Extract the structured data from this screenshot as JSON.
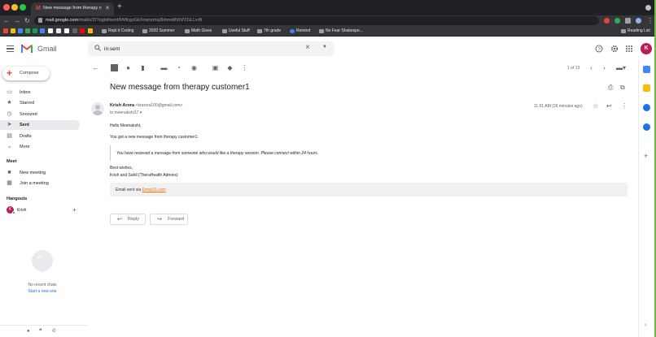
{
  "browser": {
    "tab_title": "New message from therapy cu",
    "url_host": "mail.google.com",
    "url_path": "/mail/u/2/?ogbl#sent/FMfcgzGkXcwnzmqZkbmvltNXPZGLLvrB",
    "bookmarks": [
      "Repl.it Coding",
      "2020 Summer",
      "Math Gives",
      "Useful Stuff",
      "7th grade",
      "Remind",
      "No Fear Shakespe..."
    ],
    "reading_list": "Reading List"
  },
  "gmail": {
    "logo_text": "Gmail",
    "search_value": "in:sent",
    "avatar_letter": "K",
    "compose_label": "Compose",
    "nav": [
      {
        "label": "Inbox",
        "icon": "inbox-icon"
      },
      {
        "label": "Starred",
        "icon": "star-icon"
      },
      {
        "label": "Snoozed",
        "icon": "clock-icon"
      },
      {
        "label": "Sent",
        "icon": "send-icon"
      },
      {
        "label": "Drafts",
        "icon": "draft-icon"
      },
      {
        "label": "More",
        "icon": "chevron-down-icon"
      }
    ],
    "meet": {
      "heading": "Meet",
      "new_meeting": "New meeting",
      "join_meeting": "Join a meeting"
    },
    "hangouts": {
      "heading": "Hangouts",
      "user": "Krish",
      "user_initial": "K",
      "no_chats": "No recent chats",
      "start_new": "Start a new one"
    }
  },
  "message": {
    "pager": "1 of 13",
    "subject": "New message from therapy customer1",
    "from_name": "Krish Arora",
    "from_email": "<krarora100@gmail.com>",
    "to_line": "to meenakshi17 ▾",
    "time": "11:01 AM (26 minutes ago)",
    "greeting": "Hello Meenakshi,",
    "line1": "You got a new message from therapy customer1:",
    "quote": "You have recieved a message from someone who would like a therapy session. Please connect within 24 hours.",
    "sign1": "Best wishes,",
    "sign2": "Krish and Sahil (TheraHealth Admins)",
    "footer_prefix": "Email sent via ",
    "footer_link": "EmailJS.com",
    "reply_label": "Reply",
    "forward_label": "Forward"
  },
  "colors": {
    "gmail_red": "#ea4335",
    "active_nav": "#e8eaed",
    "link": "#1a73e8",
    "accent_orange": "#ff6d00"
  }
}
